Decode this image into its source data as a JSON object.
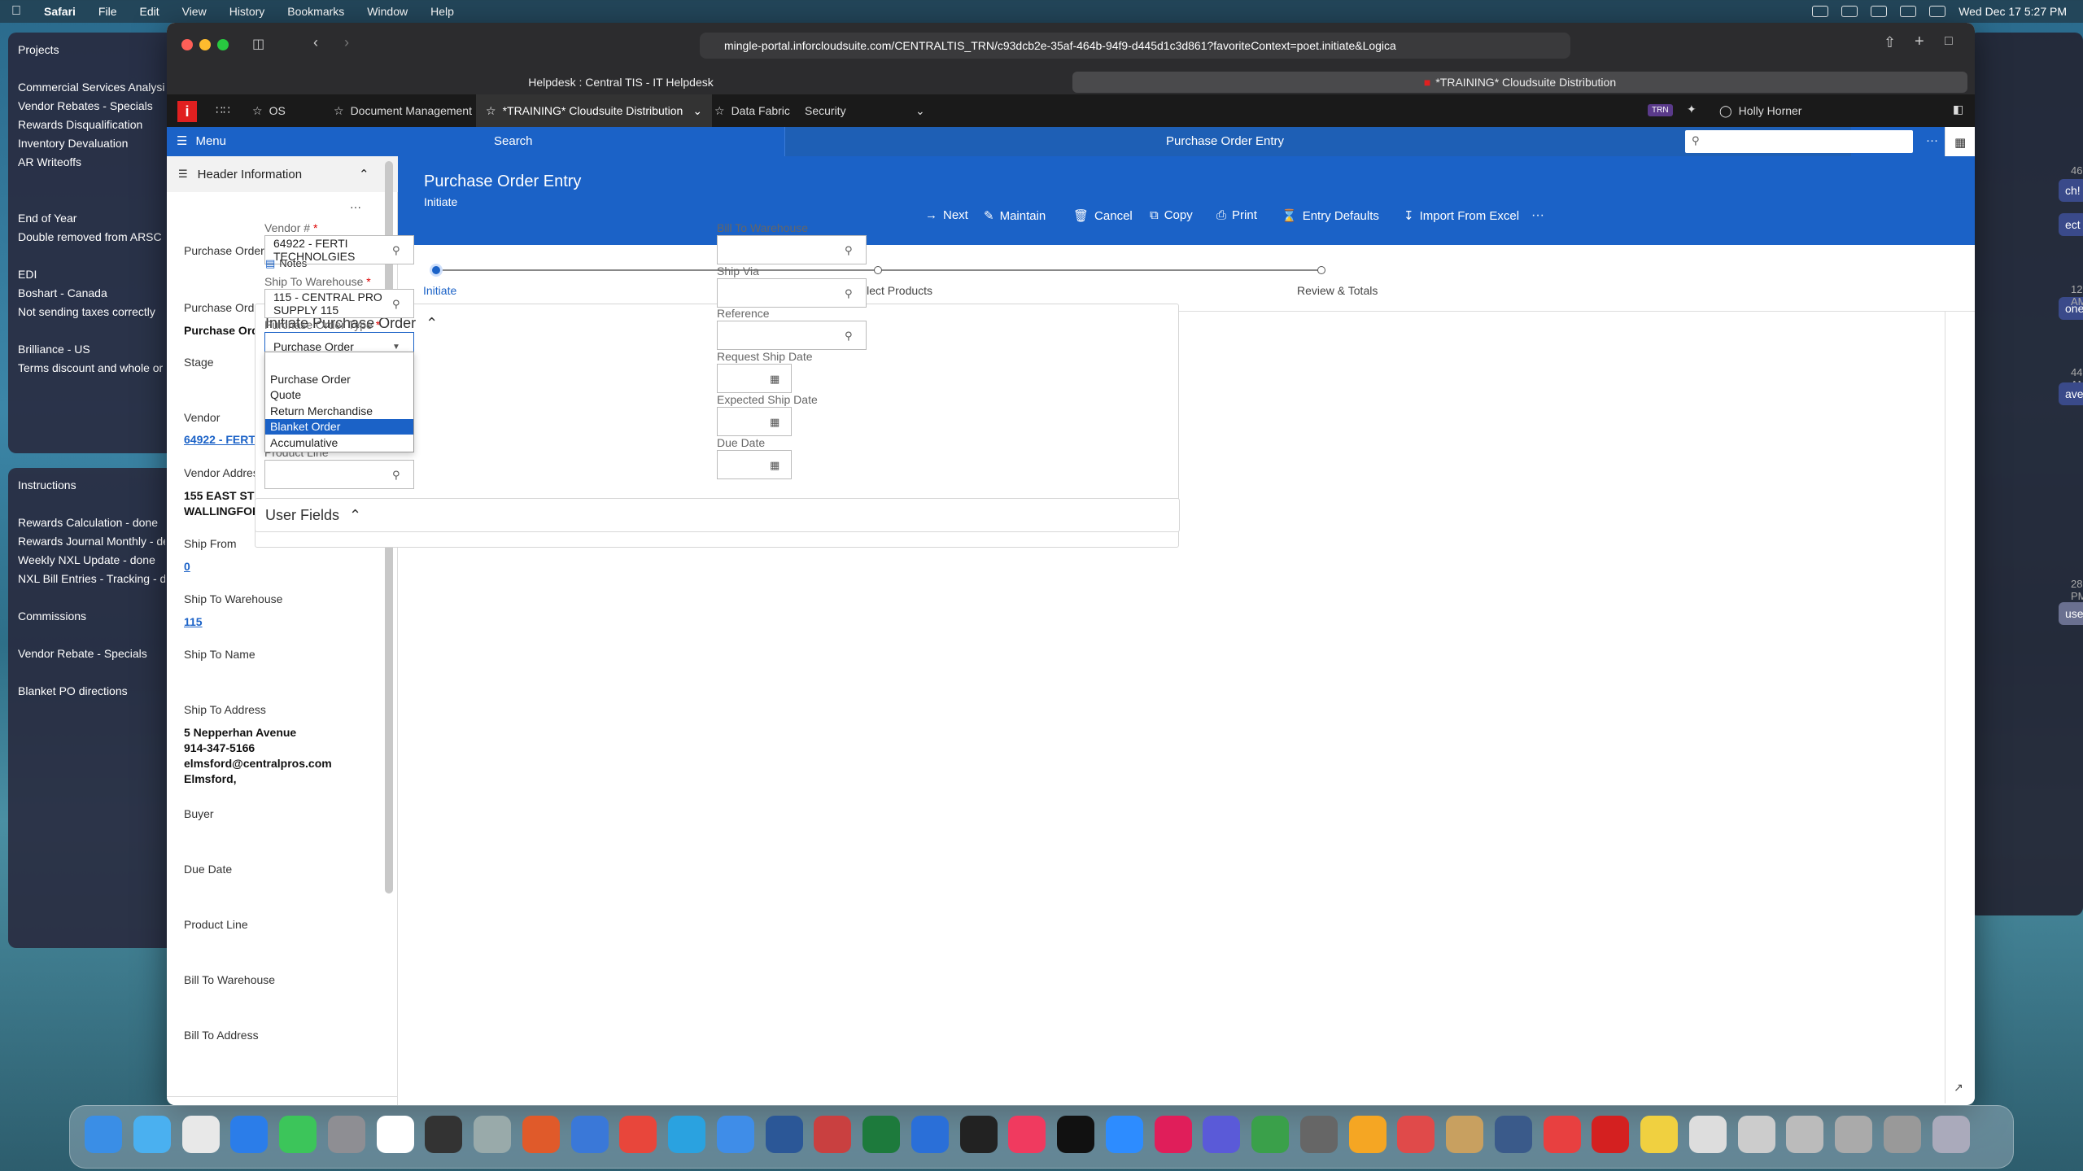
{
  "menubar": {
    "items": [
      "Safari",
      "File",
      "Edit",
      "View",
      "History",
      "Bookmarks",
      "Window",
      "Help"
    ],
    "clock": "Wed Dec 17  5:27 PM"
  },
  "notes_bg": {
    "panel1": [
      "Projects",
      "",
      "Commercial Services Analysi",
      "Vendor Rebates - Specials",
      "Rewards Disqualification",
      "Inventory Devaluation",
      "AR Writeoffs",
      "",
      "",
      "End of Year",
      "Double removed from ARSC",
      "",
      "EDI",
      "Boshart - Canada",
      "Not sending taxes correctly",
      "",
      "Brilliance - US",
      "Terms discount and whole or"
    ],
    "panel2": [
      "Instructions",
      "",
      "Rewards Calculation - done",
      "Rewards Journal Monthly - de",
      "Weekly NXL Update - done",
      "NXL Bill Entries - Tracking - de",
      "",
      "Commissions",
      "",
      "Vendor Rebate - Specials",
      "",
      "Blanket PO directions"
    ]
  },
  "chat_bg": {
    "times": [
      "46 PM",
      "12 AM",
      "44 AM",
      "28 PM"
    ],
    "msgs": [
      "ch!",
      "ect",
      "one.",
      "ave",
      "use"
    ]
  },
  "safari": {
    "url": "mingle-portal.inforcloudsuite.com/CENTRALTIS_TRN/c93dcb2e-35af-464b-94f9-d445d1c3d861?favoriteContext=poet.initiate&Logica",
    "tabs": [
      "Helpdesk : Central TIS - IT Helpdesk",
      "*TRAINING* Cloudsuite Distribution"
    ]
  },
  "infor_nav": {
    "tabs": [
      "OS",
      "Document Management",
      "*TRAINING* Cloudsuite Distribution",
      "Data Fabric",
      "Security"
    ],
    "env_badge": "TRN",
    "user": "Holly Horner"
  },
  "bluebar": {
    "menu": "Menu",
    "search": "Search",
    "title": "Purchase Order Entry"
  },
  "left_panel": {
    "header": "Header Information",
    "fields": {
      "po_num_label": "Purchase Order #",
      "po_type_label": "Purchase Order Type",
      "po_type_value": "Purchase Order",
      "stage_label": "Stage",
      "vendor_label": "Vendor",
      "vendor_value": "64922 - FERTI TECHNOLGIES",
      "vendor_addr_label": "Vendor Address",
      "vendor_addr_1": "155 EAST STREET",
      "vendor_addr_2": "WALLINGFORD, CT 06492",
      "ship_from_label": "Ship From",
      "ship_from_value": "0",
      "ship_to_wh_label": "Ship To Warehouse",
      "ship_to_wh_value": "115",
      "ship_to_name_label": "Ship To Name",
      "ship_to_addr_label": "Ship To Address",
      "ship_to_addr_1": "5 Nepperhan Avenue",
      "ship_to_addr_2": "914-347-5166",
      "ship_to_addr_3": "elmsford@centralpros.com",
      "ship_to_addr_4": "Elmsford,",
      "buyer_label": "Buyer",
      "due_date_label": "Due Date",
      "product_line_label": "Product Line",
      "bill_to_wh_label": "Bill To Warehouse",
      "bill_to_addr_label": "Bill To Address"
    }
  },
  "main": {
    "title": "Purchase Order Entry",
    "subtitle": "Initiate",
    "actions": [
      "Next",
      "Maintain",
      "Cancel",
      "Copy",
      "Print",
      "Entry Defaults",
      "Import From Excel"
    ],
    "steps": [
      "Initiate",
      "Select Products",
      "Review & Totals"
    ],
    "section_title": "Initiate Purchase Order",
    "user_fields_title": "User Fields",
    "form": {
      "vendor_label": "Vendor #",
      "vendor_value": "64922 - FERTI TECHNOLGIES",
      "notes": "Notes",
      "ship_to_wh_label": "Ship To Warehouse",
      "ship_to_wh_value": "115 - CENTRAL PRO SUPPLY 115",
      "po_type_label": "Purchase Order Type",
      "po_type_value": "Purchase Order",
      "product_line_label": "Product Line",
      "bill_to_wh_label": "Bill To Warehouse",
      "ship_via_label": "Ship Via",
      "reference_label": "Reference",
      "req_ship_date_label": "Request Ship Date",
      "exp_ship_date_label": "Expected Ship Date",
      "due_date_label": "Due Date"
    },
    "dropdown_options": [
      "",
      "Purchase Order",
      "Quote",
      "Return Merchandise",
      "Blanket Order",
      "Accumulative"
    ],
    "dropdown_selected_index": 4
  },
  "colors": {
    "infor_blue": "#1b62c7",
    "infor_red": "#e02020"
  }
}
